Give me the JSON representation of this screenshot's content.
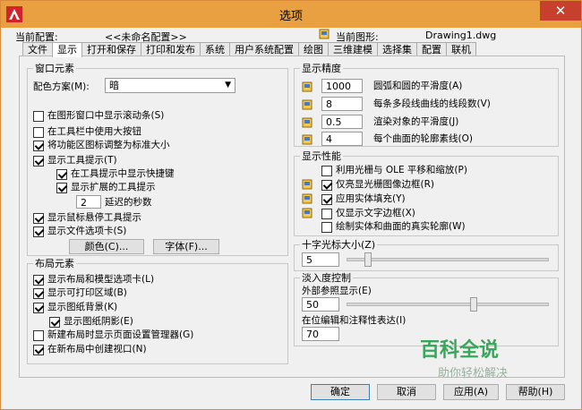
{
  "window": {
    "title": "选项",
    "close_glyph": "✕"
  },
  "config": {
    "current_config_label": "当前配置:",
    "current_config_value": "<<未命名配置>>",
    "current_drawing_label": "当前图形:",
    "current_drawing_value": "Drawing1.dwg"
  },
  "tabs": [
    "文件",
    "显示",
    "打开和保存",
    "打印和发布",
    "系统",
    "用户系统配置",
    "绘图",
    "三维建模",
    "选择集",
    "配置",
    "联机"
  ],
  "window_elements": {
    "title": "窗口元素",
    "color_scheme_label": "配色方案(M):",
    "color_scheme_value": "暗",
    "items": [
      {
        "label": "在图形窗口中显示滚动条(S)",
        "checked": false
      },
      {
        "label": "在工具栏中使用大按钮",
        "checked": false
      },
      {
        "label": "将功能区图标调整为标准大小",
        "checked": true
      },
      {
        "label": "显示工具提示(T)",
        "checked": true
      },
      {
        "label": "在工具提示中显示快捷键",
        "checked": true
      },
      {
        "label": "显示扩展的工具提示",
        "checked": true
      },
      {
        "label": "显示鼠标悬停工具提示",
        "checked": true
      },
      {
        "label": "显示文件选项卡(S)",
        "checked": true
      }
    ],
    "delay_value": "2",
    "delay_label": "延迟的秒数",
    "color_button": "颜色(C)...",
    "font_button": "字体(F)..."
  },
  "layout_elements": {
    "title": "布局元素",
    "items": [
      {
        "label": "显示布局和模型选项卡(L)",
        "checked": true
      },
      {
        "label": "显示可打印区域(B)",
        "checked": true
      },
      {
        "label": "显示图纸背景(K)",
        "checked": true
      },
      {
        "label": "显示图纸阴影(E)",
        "checked": true
      },
      {
        "label": "新建布局时显示页面设置管理器(G)",
        "checked": false
      },
      {
        "label": "在新布局中创建视口(N)",
        "checked": true
      }
    ]
  },
  "display_resolution": {
    "title": "显示精度",
    "items": [
      {
        "value": "1000",
        "label": "圆弧和圆的平滑度(A)"
      },
      {
        "value": "8",
        "label": "每条多段线曲线的线段数(V)"
      },
      {
        "value": "0.5",
        "label": "渲染对象的平滑度(J)"
      },
      {
        "value": "4",
        "label": "每个曲面的轮廓素线(O)"
      }
    ]
  },
  "display_performance": {
    "title": "显示性能",
    "items": [
      {
        "label": "利用光栅与 OLE 平移和缩放(P)",
        "checked": false
      },
      {
        "label": "仅亮显光栅图像边框(R)",
        "checked": true
      },
      {
        "label": "应用实体填充(Y)",
        "checked": true
      },
      {
        "label": "仅显示文字边框(X)",
        "checked": false
      },
      {
        "label": "绘制实体和曲面的真实轮廓(W)",
        "checked": false
      }
    ]
  },
  "crosshair": {
    "title": "十字光标大小(Z)",
    "value": "5"
  },
  "fade": {
    "title": "淡入度控制",
    "xref_label": "外部参照显示(E)",
    "xref_value": "50",
    "inplace_label": "在位编辑和注释性表达(I)",
    "inplace_value": "70"
  },
  "buttons": {
    "ok": "确定",
    "cancel": "取消",
    "apply": "应用(A)",
    "help": "帮助(H)"
  },
  "watermark": {
    "line1": "百科全说",
    "line2": "助你轻松解决"
  },
  "colors": {
    "titlebar": "#e8a040",
    "close": "#c7402e",
    "watermark": "#37a85a"
  }
}
